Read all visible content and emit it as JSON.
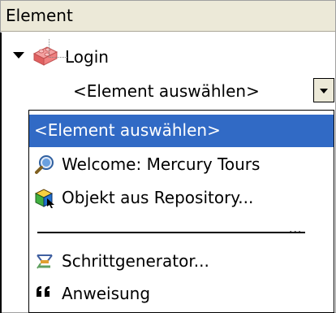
{
  "header": {
    "column_label": "Element"
  },
  "tree": {
    "root_label": "Login",
    "child_label": "<Element auswählen>"
  },
  "dropdown": {
    "items": [
      {
        "label": "<Element auswählen>",
        "icon": "none",
        "selected": true
      },
      {
        "label": "Welcome: Mercury Tours",
        "icon": "browser-page-icon"
      },
      {
        "label": "Objekt aus Repository...",
        "icon": "repository-object-icon"
      },
      {
        "label": "Schrittgenerator...",
        "icon": "step-generator-icon"
      },
      {
        "label": "Anweisung",
        "icon": "quote-statement-icon"
      }
    ],
    "separator_text": "...",
    "selected_color": "#316ac5"
  }
}
